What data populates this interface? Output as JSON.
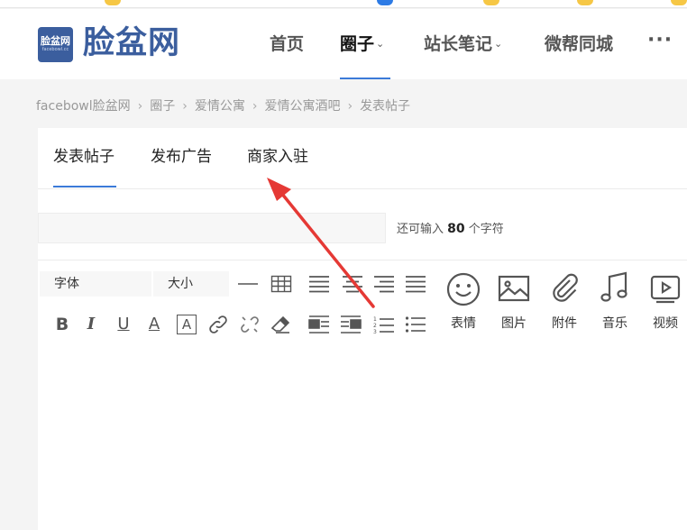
{
  "site": {
    "logo_badge_line1": "脸盆网",
    "logo_badge_line2": "facebowl.cc",
    "logo_text": "脸盆网"
  },
  "nav": {
    "items": [
      {
        "label": "首页"
      },
      {
        "label": "圈子"
      },
      {
        "label": "站长笔记"
      },
      {
        "label": "微帮同城"
      }
    ],
    "more_label": "···"
  },
  "breadcrumb": [
    "facebowl脸盆网",
    "圈子",
    "爱情公寓",
    "爱情公寓酒吧",
    "发表帖子"
  ],
  "breadcrumb_sep": "›",
  "tabs": [
    "发表帖子",
    "发布广告",
    "商家入驻"
  ],
  "title_field": {
    "value": "",
    "hint_prefix": "还可输入",
    "hint_count": "80",
    "hint_suffix": "个字符"
  },
  "toolbar": {
    "font_select": "字体",
    "size_select": "大小",
    "buttons_row1": [
      "horizontal-rule-icon",
      "table-icon",
      "align-left-icon",
      "align-center-icon",
      "align-right-icon",
      "align-justify-icon"
    ],
    "buttons_row2": [
      "bold-icon",
      "italic-icon",
      "underline-icon",
      "font-color-icon",
      "background-color-icon",
      "link-icon",
      "unlink-icon",
      "eraser-icon",
      "float-left-icon",
      "float-right-icon",
      "ordered-list-icon",
      "unordered-list-icon"
    ],
    "bold_glyph": "B",
    "italic_glyph": "I",
    "underline_glyph": "U",
    "fontcolor_glyph": "A",
    "bgcolor_glyph": "A",
    "media": [
      {
        "icon": "emoji-icon",
        "label": "表情"
      },
      {
        "icon": "image-icon",
        "label": "图片"
      },
      {
        "icon": "attachment-icon",
        "label": "附件"
      },
      {
        "icon": "music-icon",
        "label": "音乐"
      },
      {
        "icon": "video-icon",
        "label": "视频"
      }
    ]
  },
  "colors": {
    "brand": "#3b5e9e",
    "accent": "#3b7ad8",
    "arrow": "#e53935"
  }
}
